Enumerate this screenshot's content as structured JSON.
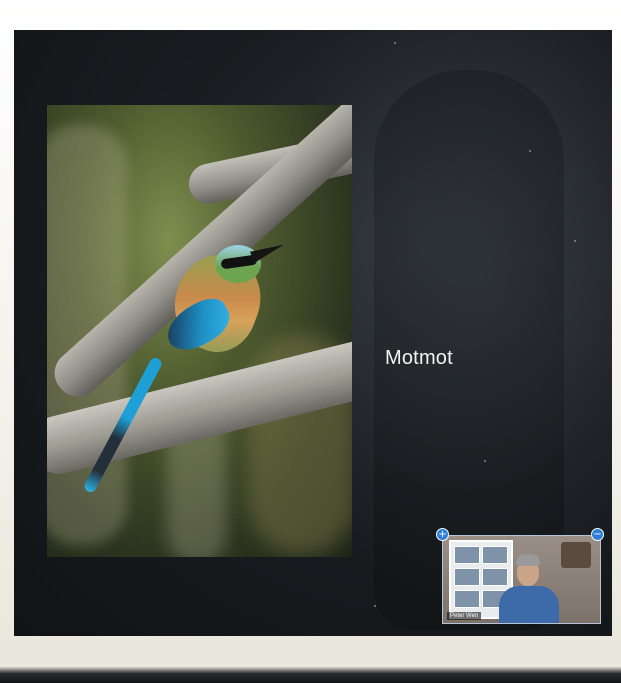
{
  "slide": {
    "caption": "Motmot"
  },
  "video_tile": {
    "participant_name": "Peter Wen",
    "expand_icon": "plus-icon",
    "minimize_icon": "minus-icon"
  },
  "tile_buttons": {
    "left_symbol": "+",
    "right_symbol": "−"
  },
  "colors": {
    "screen_background": "#1a1d21",
    "caption_text": "#f2f2f2",
    "tile_button": "#2f7fd8"
  }
}
